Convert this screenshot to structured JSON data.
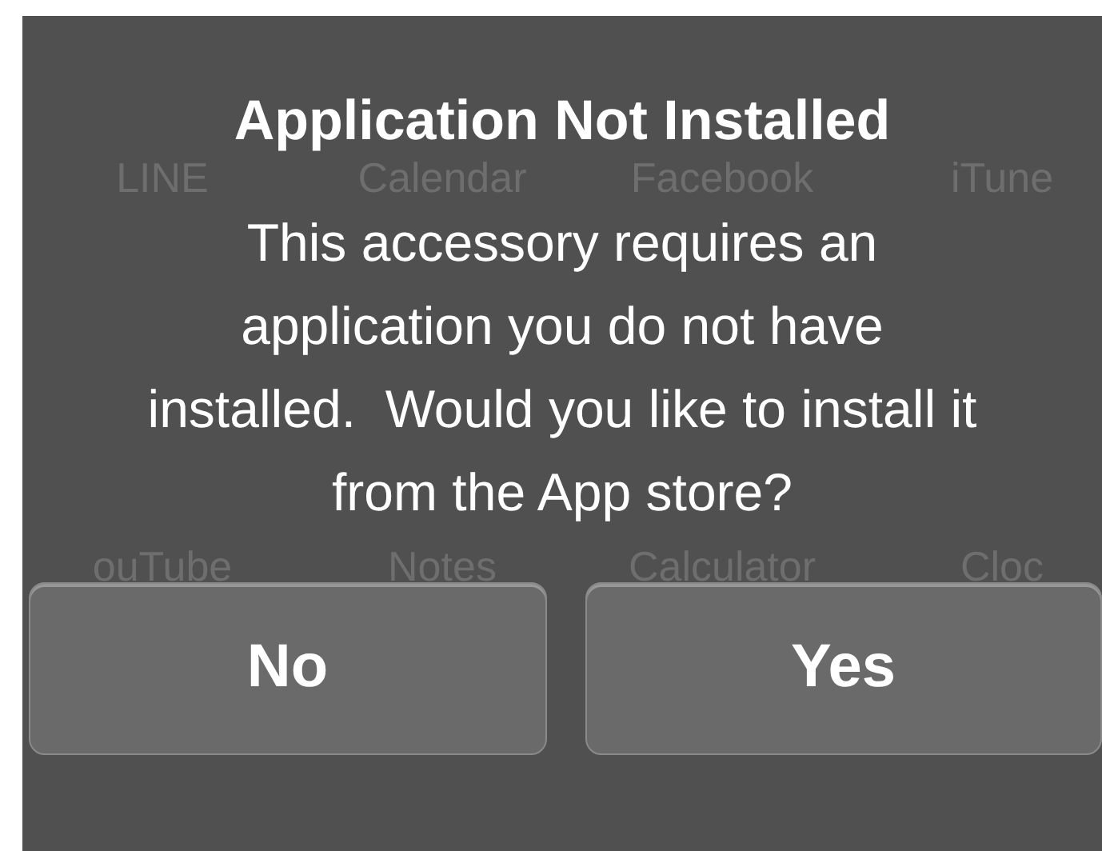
{
  "home_screen": {
    "app_labels_top": [
      "LINE",
      "Calendar",
      "Facebook",
      "iTune"
    ],
    "app_labels_bottom": [
      "ouTube",
      "Notes",
      "Calculator",
      "Cloc"
    ]
  },
  "alert": {
    "title": "Application Not Installed",
    "message": "This accessory requires an\napplication you do not have\ninstalled.  Would you like to install it\nfrom the App store?",
    "buttons": [
      {
        "label": "No"
      },
      {
        "label": "Yes"
      }
    ]
  }
}
